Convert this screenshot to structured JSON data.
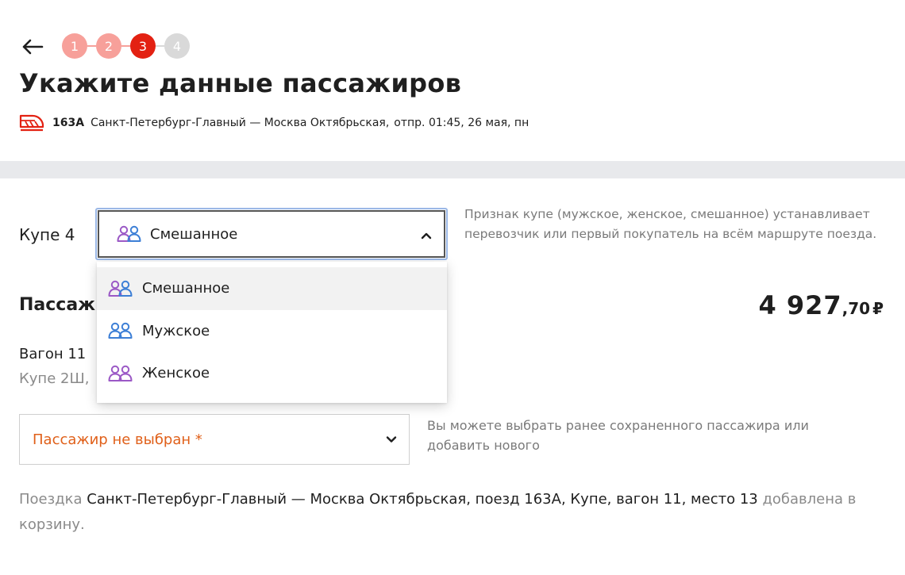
{
  "stepper": {
    "steps": [
      "1",
      "2",
      "3",
      "4"
    ],
    "current": 3
  },
  "page": {
    "title": "Укажите данные пассажиров"
  },
  "train": {
    "number": "163А",
    "route": "Санкт-Петербург-Главный — Москва Октябрьская,",
    "departure": "отпр. 01:45, 26 мая, пн"
  },
  "coupe": {
    "label": "Купе 4",
    "selected": "Смешанное",
    "hint": "Признак купе (мужское, женское, смешанное) устанавливает перевозчик или первый покупатель на всём маршруте поезда.",
    "options": [
      {
        "label": "Смешанное",
        "icon": "people-mixed-icon"
      },
      {
        "label": "Мужское",
        "icon": "people-male-icon"
      },
      {
        "label": "Женское",
        "icon": "people-female-icon"
      }
    ]
  },
  "passengers": {
    "heading": "Пассаж",
    "price_main": "4 927",
    "price_kop": ",70",
    "currency": "₽",
    "wagon": "Вагон 11 ",
    "coupe_seat": "Купе 2Ш,",
    "select_placeholder": "Пассажир не выбран *",
    "select_hint": "Вы можете выбрать ранее сохраненного пассажира или добавить нового"
  },
  "cart_note": {
    "prefix": "Поездка ",
    "trip": "Санкт-Петербург-Главный — Москва Октябрьская, поезд 163А, Купе, вагон 11, место 13",
    "suffix": " добавлена в корзину."
  },
  "colors": {
    "accent_red": "#e32112",
    "step_done": "#f7a09a",
    "step_todo": "#d9d9d9",
    "mixed_icon_purple": "#9b59c6",
    "male_icon_blue": "#3d7fd6",
    "warning_orange": "#e0601a"
  }
}
